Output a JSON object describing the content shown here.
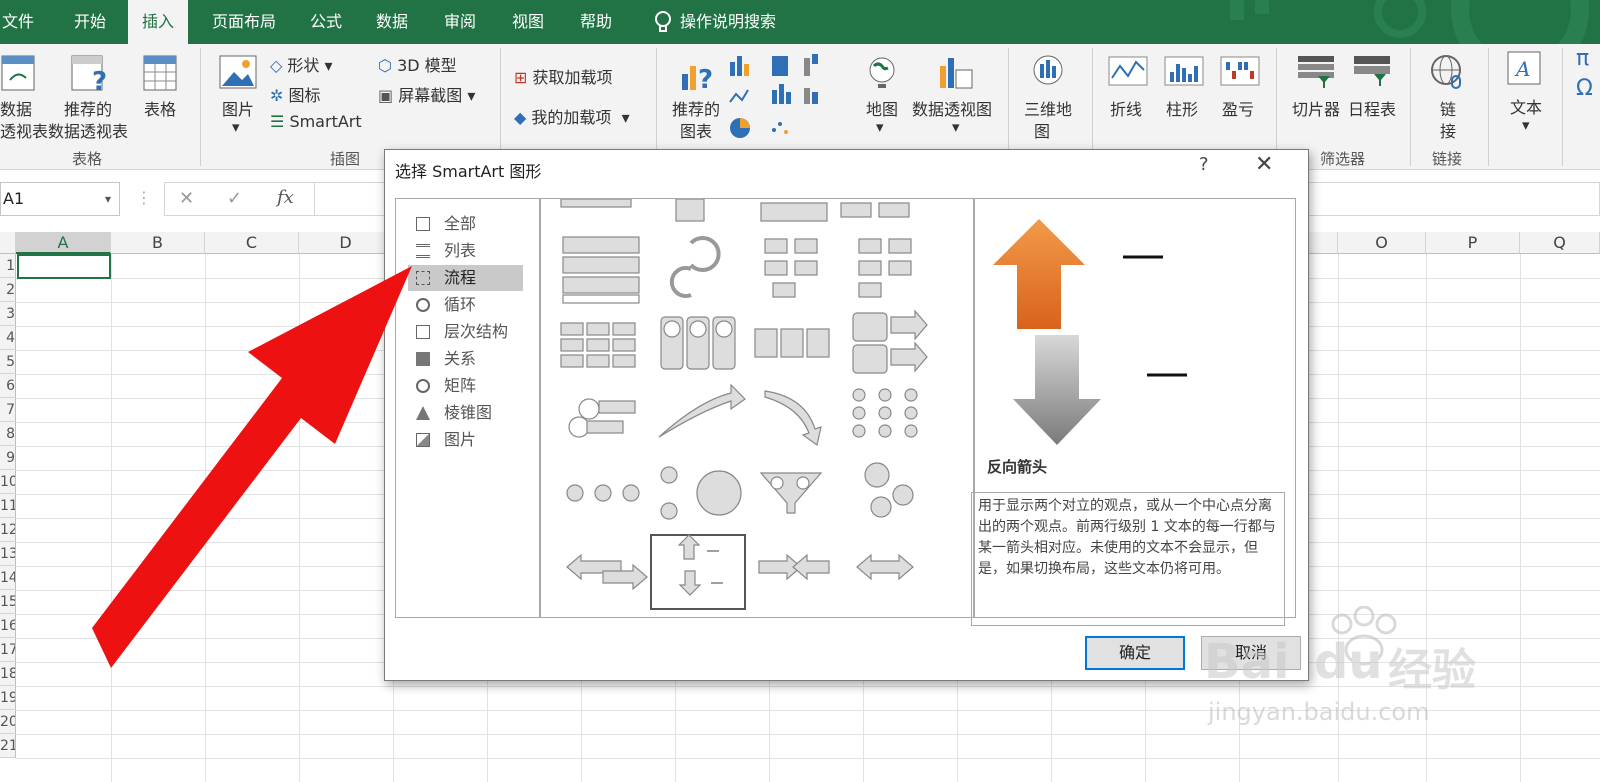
{
  "tabs": [
    "文件",
    "开始",
    "插入",
    "页面布局",
    "公式",
    "数据",
    "审阅",
    "视图",
    "帮助"
  ],
  "tab_active_index": 2,
  "search_label": "操作说明搜索",
  "ribbon": {
    "pivot_label": "数据\n透视表",
    "pivot_line1": "数据",
    "pivot_line2": "透视表",
    "rec_pivot_line1": "推荐的",
    "rec_pivot_line2": "数据透视表",
    "table_label": "表格",
    "group_tables": "表格",
    "picture_label": "图片",
    "shapes_label": "形状",
    "icons_label": "图标",
    "smartart_label": "SmartArt",
    "model3d_label": "3D 模型",
    "screenshot_label": "屏幕截图",
    "group_illustrations": "插图",
    "get_addins_label": "获取加载项",
    "my_addins_label": "我的加载项",
    "rec_chart_line1": "推荐的",
    "rec_chart_line2": "图表",
    "map_label": "地图",
    "pivotchart_label": "数据透视图",
    "map3d_line1": "三维地",
    "map3d_line2": "图",
    "line_label": "折线",
    "column_label": "柱形",
    "winloss_label": "盈亏",
    "slicer_label": "切片器",
    "timeline_label": "日程表",
    "group_filters": "筛选器",
    "link_line1": "链",
    "link_line2": "接",
    "group_links": "链接",
    "text_label": "文本",
    "pi_symbol": "π",
    "omega_symbol": "Ω"
  },
  "formula_bar": {
    "name_box": "A1",
    "cancel": "✕",
    "enter": "✓",
    "fx": "fx"
  },
  "columns_left": [
    "A",
    "B",
    "C",
    "D"
  ],
  "columns_right": [
    "O",
    "P",
    "Q"
  ],
  "rows": [
    "1",
    "2",
    "3",
    "4",
    "5",
    "6",
    "7",
    "8",
    "9",
    "10",
    "11",
    "12",
    "13",
    "14",
    "15",
    "16",
    "17",
    "18",
    "19",
    "20",
    "21"
  ],
  "dialog": {
    "title": "选择 SmartArt 图形",
    "help": "?",
    "close": "✕",
    "categories": [
      "全部",
      "列表",
      "流程",
      "循环",
      "层次结构",
      "关系",
      "矩阵",
      "棱锥图",
      "图片"
    ],
    "selected_category_index": 2,
    "preview_name": "反向箭头",
    "description": "用于显示两个对立的观点，或从一个中心点分离出的两个观点。前两行级别 1 文本的每一行都与某一箭头相对应。未使用的文本不会显示，但是，如果切换布局，这些文本仍将可用。",
    "ok": "确定",
    "cancel": "取消"
  },
  "watermark": {
    "brand": "Bai",
    "brand2": "du",
    "cn": "经验",
    "url": "jingyan.baidu.com"
  },
  "colors": {
    "excel_green": "#217346",
    "arrow_red": "#ee1111",
    "preview_orange": "#e5752a",
    "preview_gray": "#8a8a8a"
  }
}
